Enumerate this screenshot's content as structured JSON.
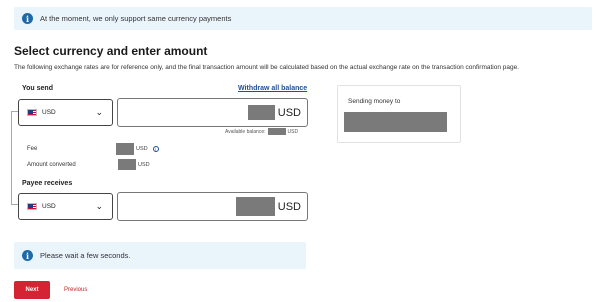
{
  "top_banner": {
    "text": "At the moment, we only support same currency payments"
  },
  "section": {
    "title": "Select currency and enter amount",
    "subtitle": "The following exchange rates are for reference only, and the final transaction amount will be calculated based on the actual exchange rate on the transaction confirmation page."
  },
  "you_send": {
    "label": "You send",
    "withdraw_link": "Withdraw all balance",
    "currency": "USD",
    "amount_currency": "USD",
    "available_balance_label": "Available balance:",
    "available_balance_currency": "USD"
  },
  "fee": {
    "label": "Fee",
    "currency": "USD",
    "info_icon": "info-circle-icon"
  },
  "amount_converted": {
    "label": "Amount converted",
    "currency": "USD"
  },
  "payee_receives": {
    "label": "Payee receives",
    "currency": "USD",
    "amount_currency": "USD"
  },
  "sending_card": {
    "label": "Sending money to"
  },
  "wait_banner": {
    "text": "Please wait a few seconds."
  },
  "actions": {
    "next_label": "Next",
    "previous_label": "Previous"
  },
  "colors": {
    "accent_red": "#d42332",
    "link_blue": "#1e4e9c",
    "banner_bg": "#eaf4fb",
    "info_blue": "#1e6aa8"
  }
}
